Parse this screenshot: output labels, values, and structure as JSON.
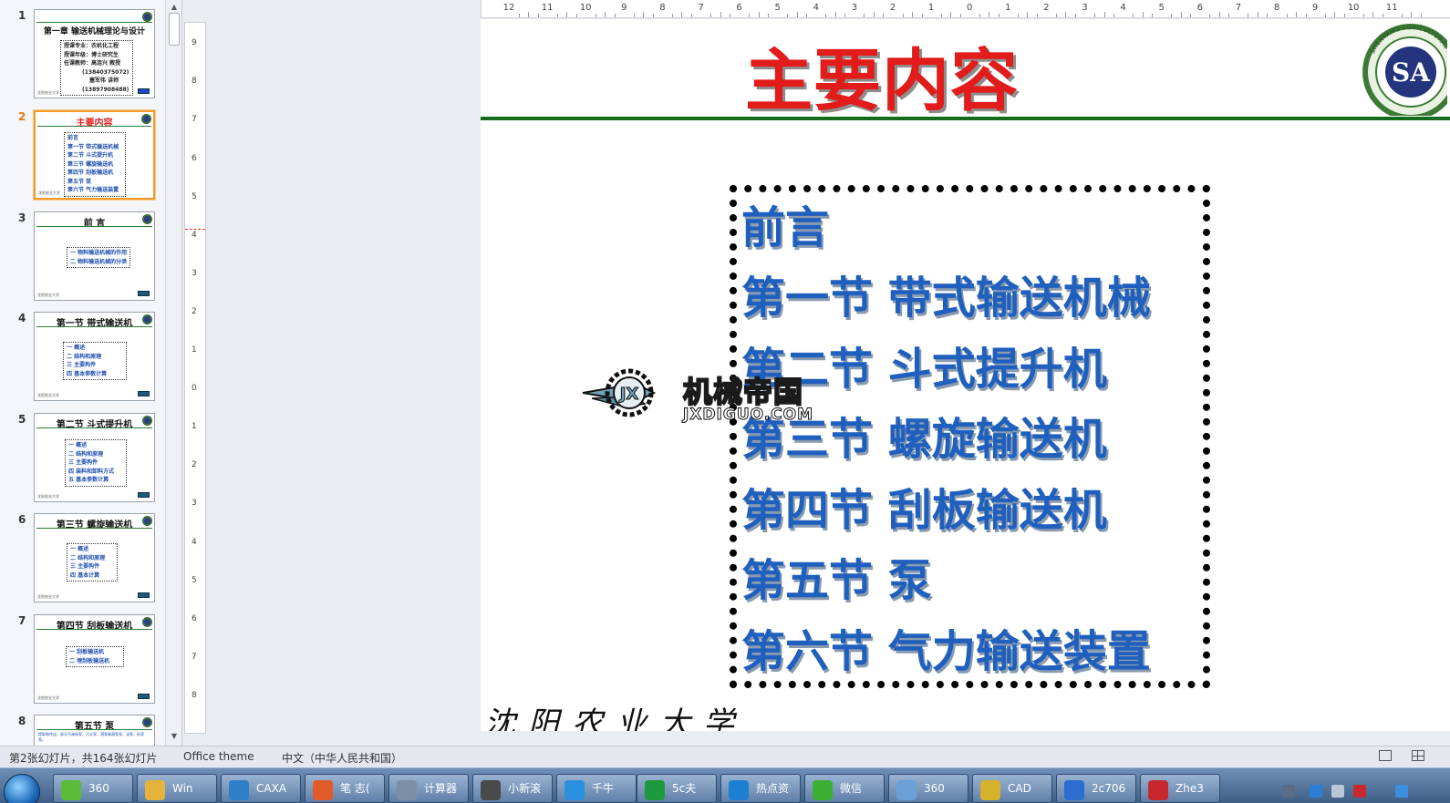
{
  "thumbnails": [
    {
      "num": "1",
      "title": "第一章  输送机械理论与设计",
      "lines": [
        "授课专业：农机化工程",
        "授课年级：博士研究生",
        "任课教师：高连兴 教授",
        "(13840375072)",
        "塞军伟 讲师",
        "(13897908488)"
      ]
    },
    {
      "num": "2",
      "title": "主要内容",
      "lines": [
        "前言",
        "第一节 带式输送机械",
        "第二节 斗式提升机",
        "第三节 螺旋输送机",
        "第四节 刮板输送机",
        "第五节 泵",
        "第六节 气力输送装置"
      ]
    },
    {
      "num": "3",
      "title": "前  言",
      "lines": [
        "一 物料输送机械的作用",
        "二 物料输送机械的分类"
      ]
    },
    {
      "num": "4",
      "title": "第一节  带式输送机",
      "lines": [
        "一 概述",
        "二 结构和原理",
        "三 主要构件",
        "四 基本参数计算"
      ]
    },
    {
      "num": "5",
      "title": "第二节    斗式提升机",
      "lines": [
        "一 概述",
        "二 结构和原理",
        "三 主要构件",
        "四 装料和卸料方式",
        "五 基本参数计算"
      ]
    },
    {
      "num": "6",
      "title": "第三节    螺旋输送机",
      "lines": [
        "一 概述",
        "二 结构和原理",
        "三 主要构件",
        "四 基本计算"
      ]
    },
    {
      "num": "7",
      "title": "第四节  刮板输送机",
      "lines": [
        "一 刮板输送机",
        "二 埋刮板输送机"
      ]
    },
    {
      "num": "8",
      "title": "第五节  泵",
      "lines": [
        "提取和传送，部分为液体泵、污水泵、潜泵做潜泵泵、油泵、砂浆泵。"
      ]
    }
  ],
  "thumb_footer": "沈阳农业大学",
  "ruler": {
    "horizontal": [
      "12",
      "11",
      "10",
      "9",
      "8",
      "7",
      "6",
      "5",
      "4",
      "3",
      "2",
      "1",
      "0",
      "1",
      "2",
      "3",
      "4",
      "5",
      "6",
      "7",
      "8",
      "9",
      "10",
      "11"
    ],
    "vertical": [
      "9",
      "8",
      "7",
      "6",
      "5",
      "4",
      "3",
      "2",
      "1",
      "0",
      "1",
      "2",
      "3",
      "4",
      "5",
      "6",
      "7",
      "8"
    ]
  },
  "slide": {
    "title": "主要内容",
    "items": [
      "前言",
      "第一节 带式输送机械",
      "第二节 斗式提升机",
      "第三节 螺旋输送机",
      "第四节 刮板输送机",
      "第五节 泵",
      "第六节 气力输送装置"
    ],
    "logo_text": "SHENYANG AGRICULTURAL UNIVERSITY",
    "logo_letters": "SA",
    "watermark_name": "机械帝国",
    "watermark_url": "JXDIGUO.COM",
    "footer": "沈阳农业大学"
  },
  "status": {
    "slide_info": "第2张幻灯片，共164张幻灯片",
    "theme": "Office theme",
    "language": "中文（中华人民共和国）"
  },
  "taskbar": [
    {
      "label": "360",
      "color": "#5dbb3a"
    },
    {
      "label": "Win",
      "color": "#e3b33c"
    },
    {
      "label": "CAXA",
      "color": "#2f7fc8"
    },
    {
      "label": "笔 志(",
      "color": "#e05a2a"
    },
    {
      "label": "计算器",
      "color": "#7d8fa6"
    },
    {
      "label": "小新滚",
      "color": "#4a4a4a"
    },
    {
      "label": "千牛",
      "color": "#2a8fe0"
    },
    {
      "label": "5c夫",
      "color": "#1d9a3f"
    },
    {
      "label": "热点资",
      "color": "#1c7fd1"
    },
    {
      "label": "微信",
      "color": "#3cb035"
    },
    {
      "label": "360",
      "color": "#6aa0d6"
    },
    {
      "label": "CAD",
      "color": "#d6b12a"
    },
    {
      "label": "2c706",
      "color": "#2b6dd1"
    },
    {
      "label": "Zhe3",
      "color": "#c8282d"
    }
  ],
  "colors": {
    "title_red": "#e21b1b",
    "toc_blue": "#1f5fbd",
    "rule_green": "#146b1c",
    "selected_orange": "#f39a2a"
  }
}
